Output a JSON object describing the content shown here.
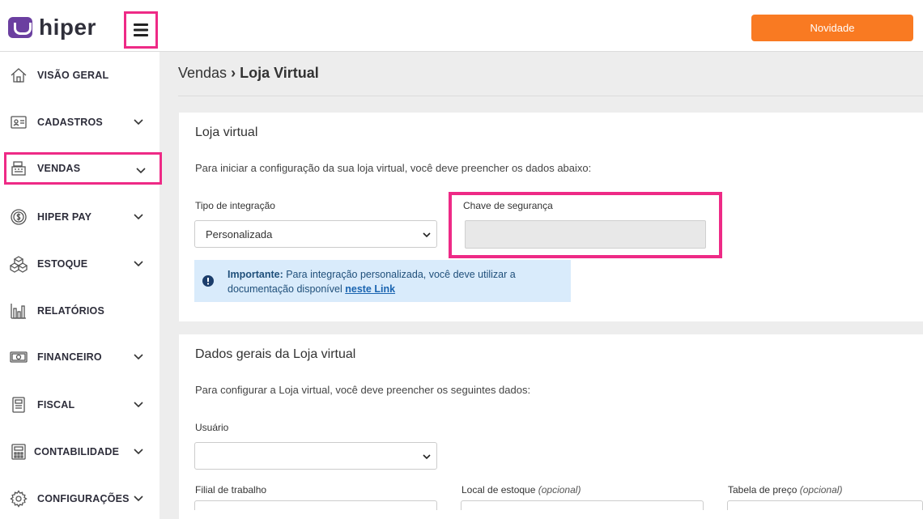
{
  "header": {
    "logo_text": "hiper",
    "novidade_label": "Novidade"
  },
  "sidebar": {
    "items": [
      {
        "label": "VISÃO GERAL",
        "icon": "home-icon",
        "expandable": false
      },
      {
        "label": "CADASTROS",
        "icon": "id-card-icon",
        "expandable": true
      },
      {
        "label": "VENDAS",
        "icon": "cash-register-icon",
        "expandable": true,
        "active": true
      },
      {
        "label": "HIPER PAY",
        "icon": "dollar-cycle-icon",
        "expandable": true
      },
      {
        "label": "ESTOQUE",
        "icon": "boxes-icon",
        "expandable": true
      },
      {
        "label": "RELATÓRIOS",
        "icon": "bar-chart-icon",
        "expandable": false
      },
      {
        "label": "FINANCEIRO",
        "icon": "banknote-icon",
        "expandable": true
      },
      {
        "label": "FISCAL",
        "icon": "receipt-icon",
        "expandable": true
      },
      {
        "label": "CONTABILIDADE",
        "icon": "calculator-icon",
        "expandable": true
      },
      {
        "label": "CONFIGURAÇÕES",
        "icon": "gear-icon",
        "expandable": true
      }
    ]
  },
  "breadcrumb": {
    "parent": "Vendas",
    "separator": "›",
    "current": "Loja Virtual"
  },
  "card1": {
    "title": "Loja virtual",
    "description": "Para iniciar a configuração da sua loja virtual, você deve preencher os dados abaixo:",
    "tipo_label": "Tipo de integração",
    "tipo_value": "Personalizada",
    "chave_label": "Chave de segurança",
    "chave_value": "",
    "alert_strong": "Importante:",
    "alert_text": " Para integração personalizada, você deve utilizar a documentação disponível ",
    "alert_link": "neste Link"
  },
  "card2": {
    "title": "Dados gerais da Loja virtual",
    "description": "Para configurar a Loja virtual, você deve preencher os seguintes dados:",
    "usuario_label": "Usuário",
    "usuario_value": "",
    "filial_label": "Filial de trabalho",
    "local_label": "Local de estoque",
    "local_optional": "(opcional)",
    "tabela_label": "Tabela de preço",
    "tabela_optional": "(opcional)"
  },
  "colors": {
    "accent_orange": "#f97a22",
    "highlight_pink": "#ee2a86",
    "brand_purple": "#6b3fa0",
    "alert_bg": "#d9ebfb"
  }
}
